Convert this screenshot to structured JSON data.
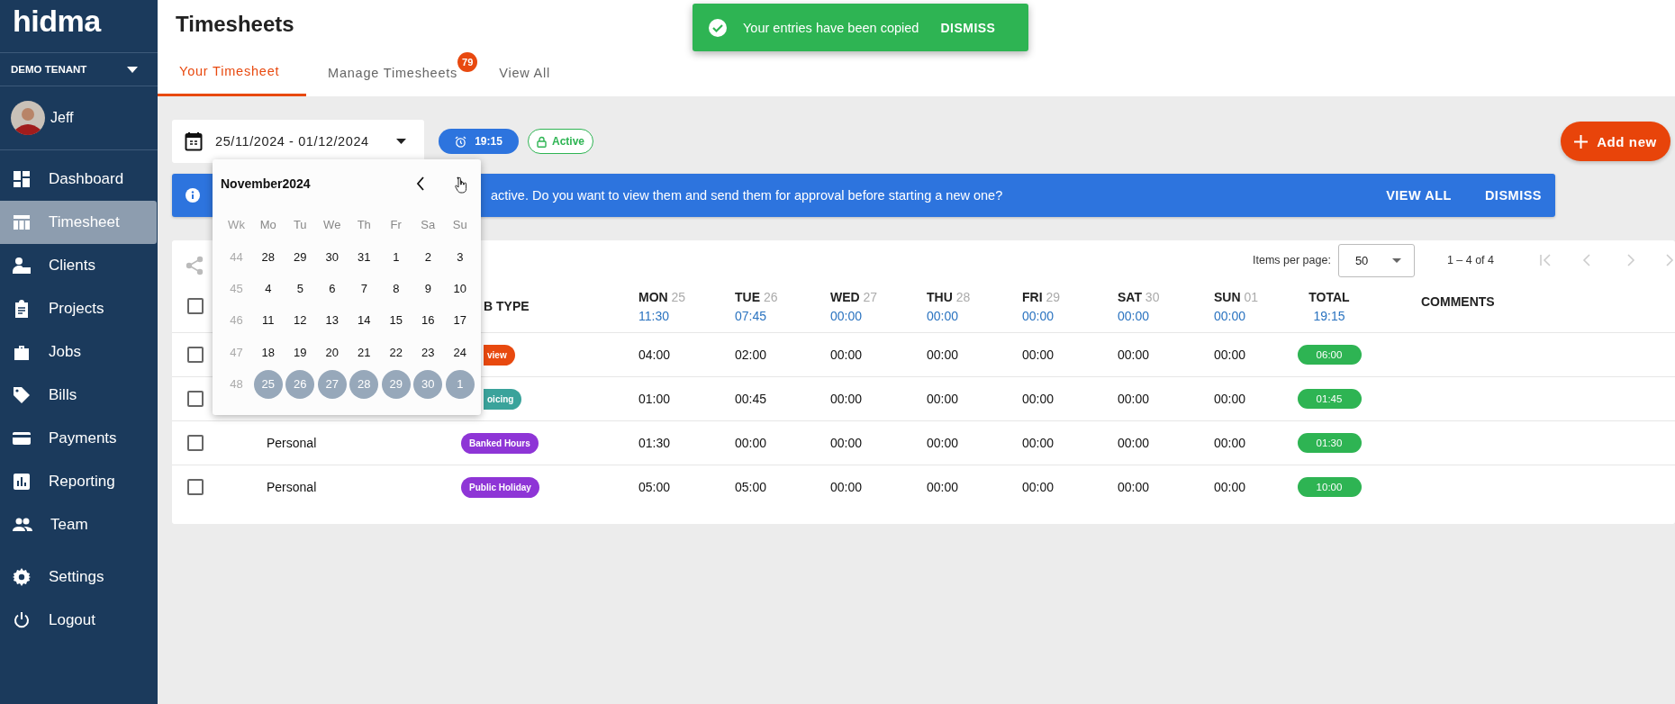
{
  "sidebar": {
    "logo": "hidma",
    "tenant": "DEMO TENANT",
    "user": "Jeff",
    "items": [
      {
        "label": "Dashboard",
        "selected": false
      },
      {
        "label": "Timesheet",
        "selected": true
      },
      {
        "label": "Clients",
        "selected": false
      },
      {
        "label": "Projects",
        "selected": false
      },
      {
        "label": "Jobs",
        "selected": false
      },
      {
        "label": "Bills",
        "selected": false
      },
      {
        "label": "Payments",
        "selected": false
      },
      {
        "label": "Reporting",
        "selected": false
      },
      {
        "label": "Team",
        "selected": false
      }
    ],
    "footer_items": [
      {
        "label": "Settings",
        "selected": false
      },
      {
        "label": "Logout",
        "selected": false
      }
    ]
  },
  "header": {
    "title": "Timesheets",
    "tabs": [
      {
        "label": "Your Timesheet",
        "selected": true
      },
      {
        "label": "Manage Timesheets",
        "selected": false,
        "badge": "79"
      },
      {
        "label": "View All",
        "selected": false
      }
    ]
  },
  "toast": {
    "message": "Your entries have been copied",
    "action": "DISMISS"
  },
  "toolbar": {
    "date_range": "25/11/2024 - 01/12/2024",
    "time": "19:15",
    "status": "Active",
    "add_button": "Add new"
  },
  "banner": {
    "message": "active. Do you want to view them and send them for approval before starting a new one?",
    "actions": [
      "VIEW ALL",
      "DISMISS"
    ]
  },
  "calendar": {
    "month": "November2024",
    "weekday_header": [
      "Wk",
      "Mo",
      "Tu",
      "We",
      "Th",
      "Fr",
      "Sa",
      "Su"
    ],
    "weeks": [
      {
        "week": "44",
        "days": [
          {
            "label": "28",
            "selected": false
          },
          {
            "label": "29",
            "selected": false
          },
          {
            "label": "30",
            "selected": false
          },
          {
            "label": "31",
            "selected": false
          },
          {
            "label": "1",
            "selected": false
          },
          {
            "label": "2",
            "selected": false
          },
          {
            "label": "3",
            "selected": false
          }
        ]
      },
      {
        "week": "45",
        "days": [
          {
            "label": "4",
            "selected": false
          },
          {
            "label": "5",
            "selected": false
          },
          {
            "label": "6",
            "selected": false
          },
          {
            "label": "7",
            "selected": false
          },
          {
            "label": "8",
            "selected": false
          },
          {
            "label": "9",
            "selected": false
          },
          {
            "label": "10",
            "selected": false
          }
        ]
      },
      {
        "week": "46",
        "days": [
          {
            "label": "11",
            "selected": false
          },
          {
            "label": "12",
            "selected": false
          },
          {
            "label": "13",
            "selected": false
          },
          {
            "label": "14",
            "selected": false
          },
          {
            "label": "15",
            "selected": false
          },
          {
            "label": "16",
            "selected": false
          },
          {
            "label": "17",
            "selected": false
          }
        ]
      },
      {
        "week": "47",
        "days": [
          {
            "label": "18",
            "selected": false
          },
          {
            "label": "19",
            "selected": false
          },
          {
            "label": "20",
            "selected": false
          },
          {
            "label": "21",
            "selected": false
          },
          {
            "label": "22",
            "selected": false
          },
          {
            "label": "23",
            "selected": false
          },
          {
            "label": "24",
            "selected": false
          }
        ]
      },
      {
        "week": "48",
        "days": [
          {
            "label": "25",
            "selected": true
          },
          {
            "label": "26",
            "selected": true
          },
          {
            "label": "27",
            "selected": true
          },
          {
            "label": "28",
            "selected": true
          },
          {
            "label": "29",
            "selected": true
          },
          {
            "label": "30",
            "selected": true
          },
          {
            "label": "1",
            "selected": true
          }
        ]
      }
    ]
  },
  "table": {
    "items_per_page_label": "Items per page:",
    "items_per_page": "50",
    "range": "1 – 4 of 4",
    "header": {
      "checked": false,
      "job_type": "B TYPE",
      "days": [
        {
          "name": "MON",
          "date": "25",
          "total": "11:30"
        },
        {
          "name": "TUE",
          "date": "26",
          "total": "07:45"
        },
        {
          "name": "WED",
          "date": "27",
          "total": "00:00"
        },
        {
          "name": "THU",
          "date": "28",
          "total": "00:00"
        },
        {
          "name": "FRI",
          "date": "29",
          "total": "00:00"
        },
        {
          "name": "SAT",
          "date": "30",
          "total": "00:00"
        },
        {
          "name": "SUN",
          "date": "01",
          "total": "00:00"
        }
      ],
      "total_label": "TOTAL",
      "total": "19:15",
      "comments": "COMMENTS"
    },
    "rows": [
      {
        "checked": false,
        "job_type": {
          "label": "view",
          "color": "#e8490f",
          "clipped": true
        },
        "hours": [
          "04:00",
          "02:00",
          "00:00",
          "00:00",
          "00:00",
          "00:00",
          "00:00"
        ],
        "total": "06:00"
      },
      {
        "checked": false,
        "job_type": {
          "label": "oicing",
          "color": "#3aa39b",
          "clipped": true
        },
        "hours": [
          "01:00",
          "00:45",
          "00:00",
          "00:00",
          "00:00",
          "00:00",
          "00:00"
        ],
        "total": "01:45"
      },
      {
        "checked": false,
        "client": "Personal",
        "job_type": {
          "label": "Banked Hours",
          "color": "#8e35d6",
          "clipped": false
        },
        "hours": [
          "01:30",
          "00:00",
          "00:00",
          "00:00",
          "00:00",
          "00:00",
          "00:00"
        ],
        "total": "01:30"
      },
      {
        "checked": false,
        "client": "Personal",
        "job_type": {
          "label": "Public Holiday",
          "color": "#8e35d6",
          "clipped": false
        },
        "hours": [
          "05:00",
          "05:00",
          "00:00",
          "00:00",
          "00:00",
          "00:00",
          "00:00"
        ],
        "total": "10:00"
      }
    ]
  }
}
